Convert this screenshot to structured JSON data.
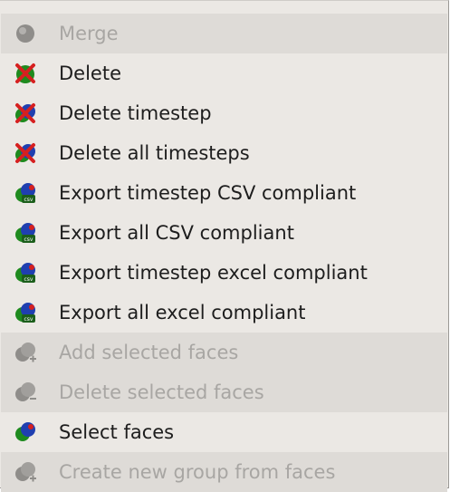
{
  "menu": {
    "items": [
      {
        "label": "Merge",
        "icon": "merge-icon",
        "enabled": false
      },
      {
        "label": "Delete",
        "icon": "delete-icon",
        "enabled": true
      },
      {
        "label": "Delete timestep",
        "icon": "delete-timestep-icon",
        "enabled": true
      },
      {
        "label": "Delete all timesteps",
        "icon": "delete-all-timesteps-icon",
        "enabled": true
      },
      {
        "label": "Export timestep CSV compliant",
        "icon": "export-csv-icon",
        "enabled": true
      },
      {
        "label": "Export all CSV compliant",
        "icon": "export-csv-icon",
        "enabled": true
      },
      {
        "label": "Export timestep excel compliant",
        "icon": "export-excel-icon",
        "enabled": true
      },
      {
        "label": "Export all excel compliant",
        "icon": "export-excel-icon",
        "enabled": true
      },
      {
        "label": "Add selected faces",
        "icon": "add-faces-icon",
        "enabled": false
      },
      {
        "label": "Delete selected faces",
        "icon": "delete-faces-icon",
        "enabled": false
      },
      {
        "label": "Select faces",
        "icon": "select-faces-icon",
        "enabled": true
      },
      {
        "label": "Create new group from faces",
        "icon": "create-group-icon",
        "enabled": false
      }
    ],
    "colors": {
      "background": "#ebe8e4",
      "disabled_background": "#dedbd7",
      "text": "#1d1d1d",
      "disabled_text": "#a8a6a3",
      "green": "#1e8a1e",
      "blue": "#1f3fb0",
      "red": "#d62020"
    }
  }
}
